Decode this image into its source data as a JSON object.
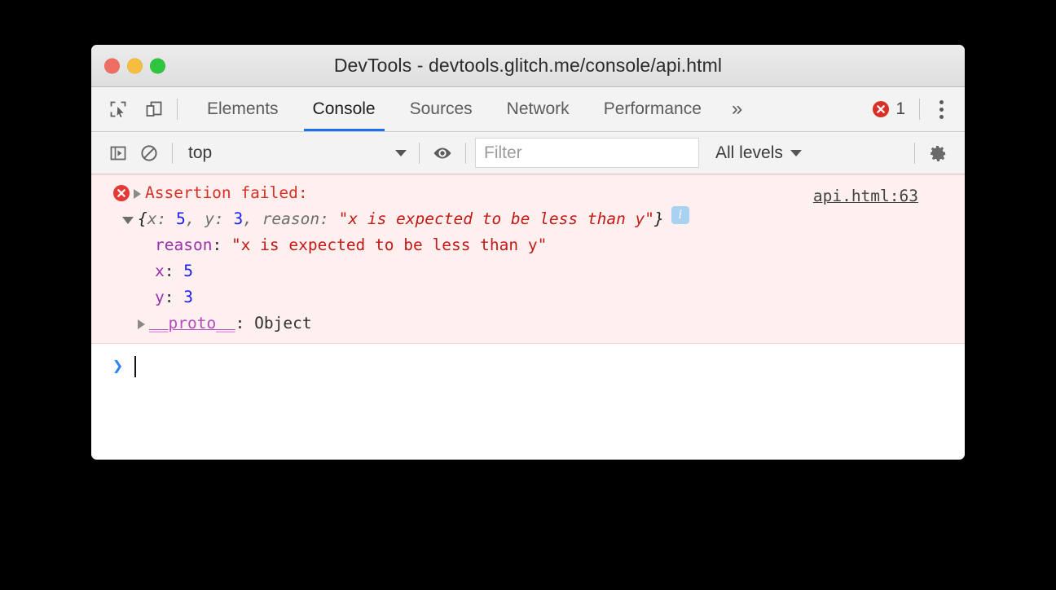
{
  "window": {
    "title": "DevTools - devtools.glitch.me/console/api.html",
    "traffic_lights": [
      {
        "name": "close",
        "color": "#ef6e63"
      },
      {
        "name": "minimize",
        "color": "#f7bd3f"
      },
      {
        "name": "zoom",
        "color": "#30c53e"
      }
    ]
  },
  "tabbar": {
    "icons": [
      {
        "name": "inspect-element-icon",
        "title": "Inspect element"
      },
      {
        "name": "device-toolbar-icon",
        "title": "Toggle device toolbar"
      }
    ],
    "tabs": [
      {
        "label": "Elements",
        "active": false
      },
      {
        "label": "Console",
        "active": true
      },
      {
        "label": "Sources",
        "active": false
      },
      {
        "label": "Network",
        "active": false
      },
      {
        "label": "Performance",
        "active": false
      }
    ],
    "more_label": "»",
    "error_count": "1",
    "error_color": "#d93025",
    "active_tab_underline": "#1a73e8"
  },
  "console_toolbar": {
    "sidebar_toggle": "console-sidebar-icon",
    "clear_console": "clear-console-icon",
    "context": {
      "value": "top"
    },
    "live_expression": "eye-icon",
    "filter": {
      "placeholder": "Filter",
      "value": ""
    },
    "levels": {
      "value": "All levels"
    },
    "settings": "gear-icon"
  },
  "console": {
    "message": {
      "level": "error",
      "icon": "error-circle-icon",
      "title": "Assertion failed:",
      "source_link": "api.html:63",
      "preview": {
        "open_brace": "{",
        "parts": [
          {
            "key": "x: ",
            "value": "5",
            "type": "number",
            "sep": ", "
          },
          {
            "key": "y: ",
            "value": "3",
            "type": "number",
            "sep": ", "
          },
          {
            "key": "reason: ",
            "value": "\"x is expected to be less than y\"",
            "type": "string",
            "sep": ""
          }
        ],
        "close_brace": "}",
        "badge": "i"
      },
      "properties": [
        {
          "key": "reason",
          "value": "\"x is expected to be less than y\"",
          "type": "string"
        },
        {
          "key": "x",
          "value": "5",
          "type": "number"
        },
        {
          "key": "y",
          "value": "3",
          "type": "number"
        }
      ],
      "proto": {
        "key": "__proto__",
        "separator": ": ",
        "value": "Object"
      }
    },
    "prompt": {
      "chevron": "›",
      "value": ""
    },
    "colors": {
      "error_bg": "#fff0f0",
      "error_border": "#ffd6d6",
      "error_text": "#d93025",
      "string": "#c41a16",
      "number": "#1a1aff",
      "property": "#9b2fae",
      "badge_bg": "#a8d2f0"
    }
  }
}
